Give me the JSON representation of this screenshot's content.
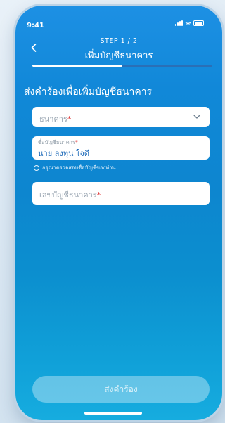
{
  "status_bar": {
    "time": "9:41"
  },
  "header": {
    "step": "STEP 1 / 2",
    "title": "เพิ่มบัญชีธนาคาร",
    "back_icon": "chevron-left-icon"
  },
  "progress": {
    "fraction": 0.5
  },
  "form": {
    "heading": "ส่งคำร้องเพื่อเพิ่มบัญชีธนาคาร",
    "bank": {
      "placeholder": "ธนาคาร",
      "required_mark": "*"
    },
    "account_name": {
      "label": "ชื่อบัญชีธนาคาร",
      "required_mark": "*",
      "value": "นาย ลงทุน ใจดี"
    },
    "hint": "กรุณาตรวจสอบชื่อบัญชีของท่าน",
    "account_number": {
      "placeholder": "เลขบัญชีธนาคาร",
      "required_mark": "*"
    }
  },
  "submit": {
    "label": "ส่งคำร้อง"
  },
  "colors": {
    "accent": "#1a68b8",
    "required": "#e03a3a"
  }
}
